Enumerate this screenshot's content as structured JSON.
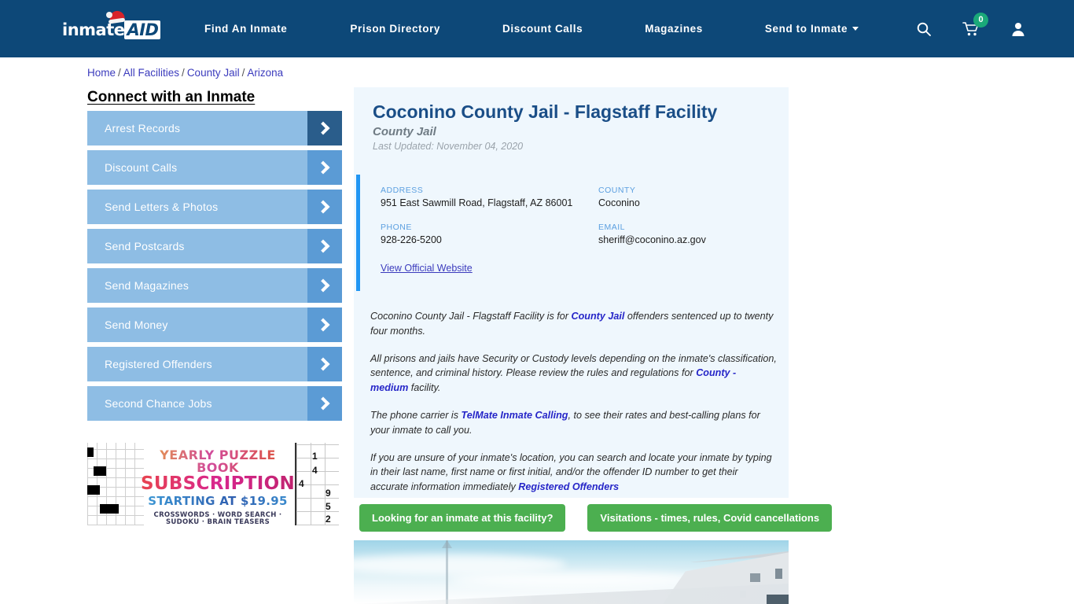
{
  "brand": {
    "logo_text_1": "inmate",
    "logo_text_2": "AID",
    "icon_santa_hat": "santa-hat-icon",
    "header_bg": "#0d4878",
    "accent_blue": "#2196f3",
    "cta_green": "#4caf50",
    "badge_green": "#1aa979"
  },
  "nav": {
    "items": [
      {
        "label": "Find An Inmate"
      },
      {
        "label": "Prison Directory"
      },
      {
        "label": "Discount Calls"
      },
      {
        "label": "Magazines"
      },
      {
        "label": "Send to Inmate",
        "has_caret": true
      }
    ],
    "icons": {
      "search": "search-icon",
      "cart": "shopping-cart-icon",
      "cart_count": "0",
      "account": "user-account-icon"
    }
  },
  "breadcrumb": {
    "items": [
      "Home",
      "All Facilities",
      "County Jail",
      "Arizona"
    ],
    "separator": "/"
  },
  "sidebar": {
    "title": "Connect with an Inmate",
    "items": [
      {
        "label": "Arrest Records"
      },
      {
        "label": "Discount Calls"
      },
      {
        "label": "Send Letters & Photos"
      },
      {
        "label": "Send Postcards"
      },
      {
        "label": "Send Magazines"
      },
      {
        "label": "Send Money"
      },
      {
        "label": "Registered Offenders"
      },
      {
        "label": "Second Chance Jobs"
      }
    ]
  },
  "ad": {
    "line1": "YEARLY PUZZLE BOOK",
    "line2": "SUBSCRIPTIONS",
    "line3": "STARTING AT $19.95",
    "line4": "CROSSWORDS · WORD SEARCH · SUDOKU · BRAIN TEASERS",
    "sudoku_digits": [
      "1",
      "4",
      "4",
      "9",
      "5",
      "2"
    ]
  },
  "facility": {
    "title": "Coconino County Jail - Flagstaff Facility",
    "subtitle": "County Jail",
    "last_updated": "Last Updated: November 04, 2020",
    "info": {
      "address_label": "ADDRESS",
      "address_value": "951 East Sawmill Road, Flagstaff, AZ 86001",
      "county_label": "COUNTY",
      "county_value": "Coconino",
      "phone_label": "PHONE",
      "phone_value": "928-226-5200",
      "email_label": "EMAIL",
      "email_value": "sheriff@coconino.az.gov",
      "website_link": "View Official Website"
    },
    "paragraphs": [
      {
        "parts": [
          {
            "text": "Coconino County Jail - Flagstaff Facility is for ",
            "link": false
          },
          {
            "text": "County Jail",
            "link": true
          },
          {
            "text": " offenders sentenced up to twenty four months.",
            "link": false
          }
        ]
      },
      {
        "parts": [
          {
            "text": "All prisons and jails have Security or Custody levels depending on the inmate's classification, sentence, and criminal history. Please review the rules and regulations for ",
            "link": false
          },
          {
            "text": "County - medium",
            "link": true
          },
          {
            "text": " facility.",
            "link": false
          }
        ]
      },
      {
        "parts": [
          {
            "text": "The phone carrier is ",
            "link": false
          },
          {
            "text": "TelMate Inmate Calling",
            "link": true
          },
          {
            "text": ", to see their rates and best-calling plans for your inmate to call you.",
            "link": false
          }
        ]
      },
      {
        "parts": [
          {
            "text": "If you are unsure of your inmate's location, you can search and locate your inmate by typing in their last name, first name or first initial, and/or the offender ID number to get their accurate information immediately ",
            "link": false
          },
          {
            "text": "Registered Offenders",
            "link": true
          }
        ]
      }
    ]
  },
  "cta": {
    "primary": "Looking for an inmate at this facility?",
    "secondary": "Visitations - times, rules, Covid cancellations"
  },
  "photo": {
    "alt": "facility-exterior-photo"
  }
}
